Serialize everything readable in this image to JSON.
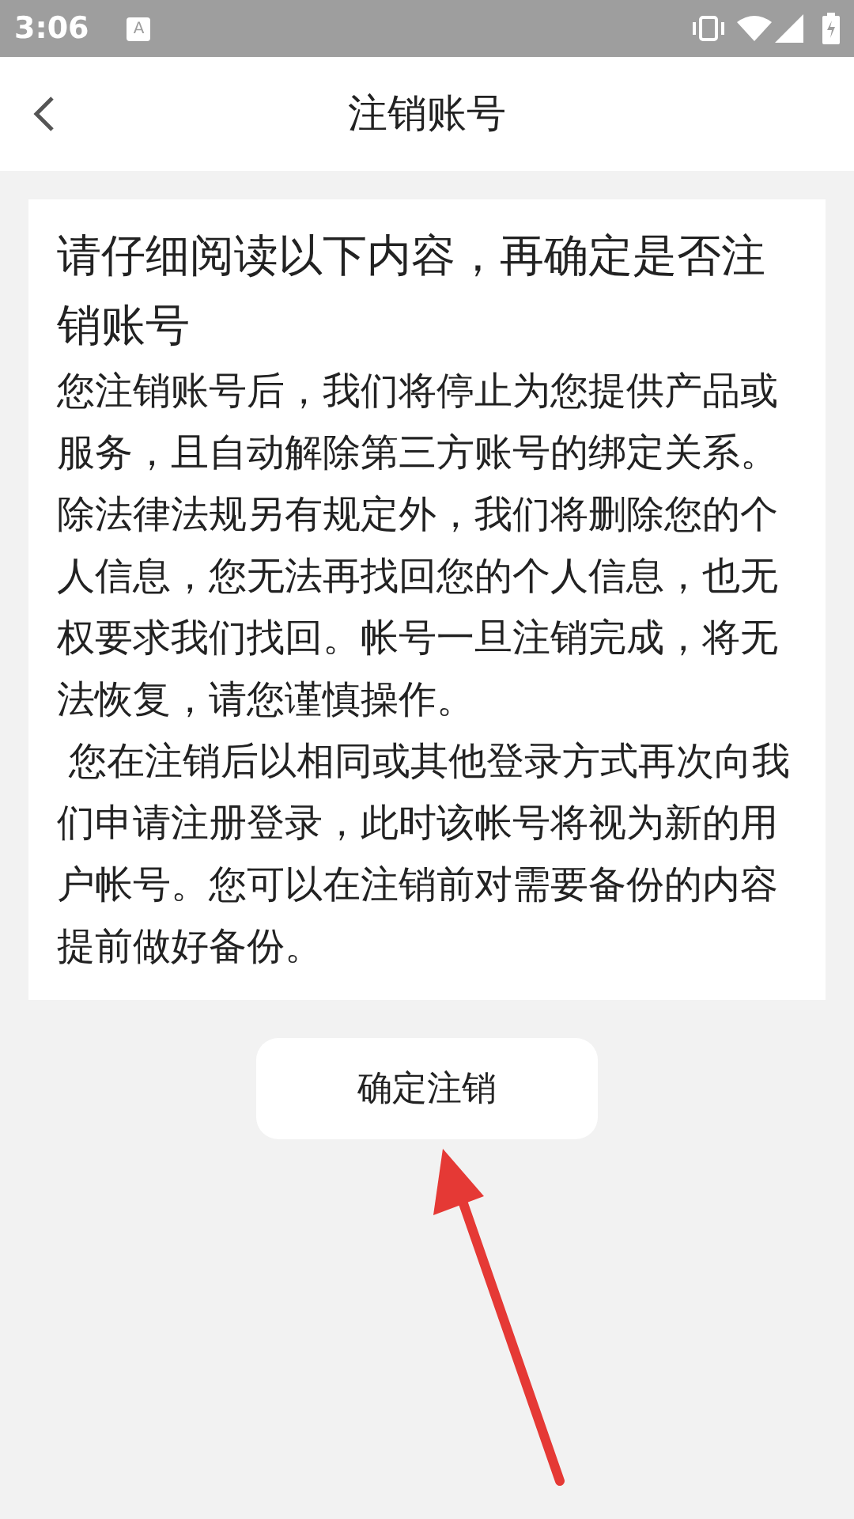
{
  "status_bar": {
    "time": "3:06",
    "notification_glyph": "A"
  },
  "header": {
    "title": "注销账号"
  },
  "notice": {
    "title": "请仔细阅读以下内容，再确定是否注销账号",
    "paragraphs": [
      "您注销账号后，我们将停止为您提供产品或服务，且自动解除第三方账号的绑定关系。除法律法规另有规定外，我们将删除您的个人信息，您无法再找回您的个人信息，也无权要求我们找回。帐号一旦注销完成，将无法恢复，请您谨慎操作。",
      " 您在注销后以相同或其他登录方式再次向我们申请注册登录，此时该帐号将视为新的用户帐号。您可以在注销前对需要备份的内容提前做好备份。"
    ]
  },
  "confirm_button": "确定注销"
}
